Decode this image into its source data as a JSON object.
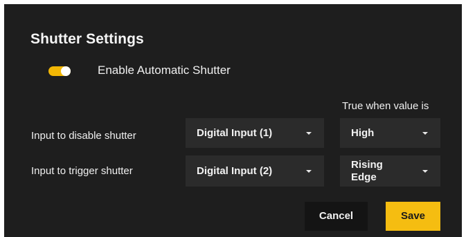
{
  "dialog": {
    "title": "Shutter Settings"
  },
  "auto_shutter": {
    "label": "Enable Automatic Shutter",
    "enabled": true,
    "accent_color": "#f2b705"
  },
  "table": {
    "column_header": "True when value is",
    "rows": [
      {
        "label": "Input to disable shutter",
        "input": "Digital Input (1)",
        "condition": "High"
      },
      {
        "label": "Input to trigger shutter",
        "input": "Digital Input (2)",
        "condition": "Rising Edge"
      }
    ]
  },
  "buttons": {
    "cancel": "Cancel",
    "save": "Save",
    "save_color": "#f5bd11"
  },
  "icons": {
    "dropdown": "chevron-down-icon"
  }
}
